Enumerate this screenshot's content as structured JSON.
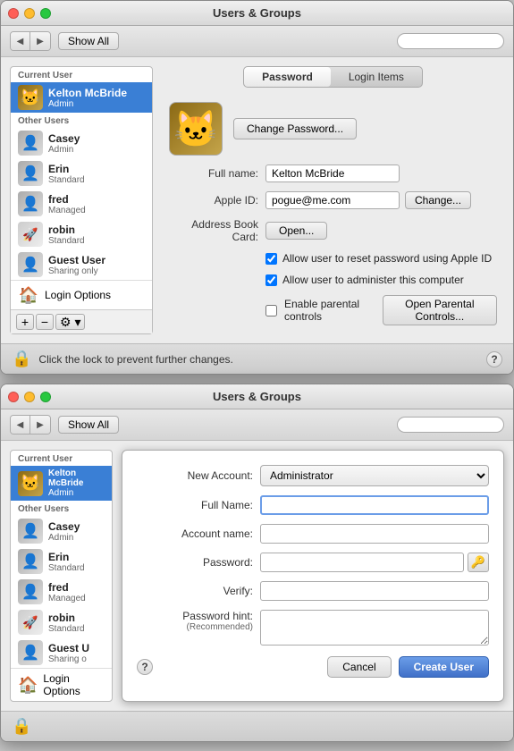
{
  "window1": {
    "title": "Users & Groups",
    "traffic_lights": [
      "red",
      "yellow",
      "green"
    ],
    "toolbar": {
      "back_label": "◀",
      "forward_label": "▶",
      "show_all_label": "Show All",
      "search_placeholder": ""
    },
    "sidebar": {
      "current_user_label": "Current User",
      "current_user": {
        "name": "Kelton McBride",
        "role": "Admin",
        "avatar": "🐱"
      },
      "other_users_label": "Other Users",
      "users": [
        {
          "name": "Casey",
          "role": "Admin",
          "avatar": "👤"
        },
        {
          "name": "Erin",
          "role": "Standard",
          "avatar": "👤"
        },
        {
          "name": "fred",
          "role": "Managed",
          "avatar": "👤"
        },
        {
          "name": "robin",
          "role": "Standard",
          "avatar": "🚀"
        },
        {
          "name": "Guest User",
          "role": "Sharing only",
          "avatar": "👤"
        }
      ],
      "login_options_label": "Login Options",
      "add_label": "+",
      "remove_label": "−",
      "gear_label": "⚙ ▾"
    },
    "tabs": {
      "password_label": "Password",
      "login_items_label": "Login Items"
    },
    "main": {
      "full_name_label": "Full name:",
      "full_name_value": "Kelton McBride",
      "apple_id_label": "Apple ID:",
      "apple_id_value": "pogue@me.com",
      "change_label": "Change...",
      "address_book_label": "Address Book Card:",
      "open_label": "Open...",
      "change_password_label": "Change Password...",
      "checkbox1_label": "Allow user to reset password using Apple ID",
      "checkbox2_label": "Allow user to administer this computer",
      "checkbox3_label": "Enable parental controls",
      "open_parental_label": "Open Parental Controls..."
    },
    "bottom_bar": {
      "lock_text": "Click the lock to prevent further changes.",
      "help_label": "?"
    }
  },
  "window2": {
    "title": "Users & Groups",
    "dialog": {
      "new_account_label": "New Account:",
      "new_account_value": "Administrator",
      "full_name_label": "Full Name:",
      "full_name_placeholder": "",
      "account_name_label": "Account name:",
      "password_label": "Password:",
      "verify_label": "Verify:",
      "password_hint_label": "Password hint:",
      "password_hint_sub": "(Recommended)",
      "key_icon": "🔑",
      "cancel_label": "Cancel",
      "create_user_label": "Create User",
      "help_label": "?"
    }
  }
}
